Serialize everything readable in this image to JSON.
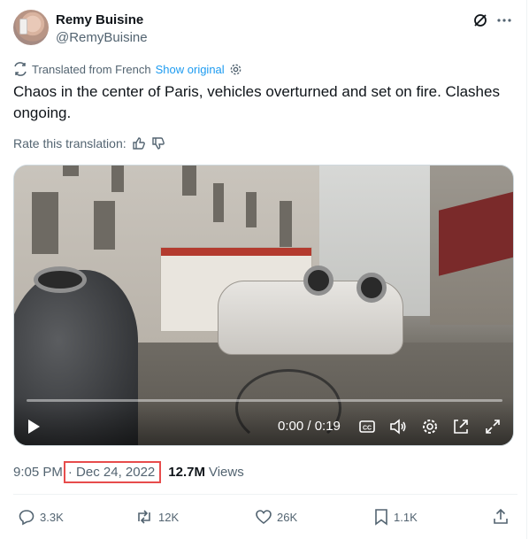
{
  "author": {
    "name": "Remy Buisine",
    "handle": "@RemyBuisine"
  },
  "header_icons": [
    "grok-icon",
    "more-icon"
  ],
  "translation": {
    "label": "Translated from French",
    "link": "Show original"
  },
  "tweet": {
    "text": "Chaos in the center of Paris, vehicles overturned and set on fire. Clashes ongoing."
  },
  "rate": {
    "label": "Rate this translation:"
  },
  "video": {
    "time": "0:00 / 0:19",
    "progress": 0
  },
  "meta": {
    "time": "9:05 PM",
    "sep": "·",
    "date": "Dec 24, 2022",
    "views_count": "12.7M",
    "views_label": "Views"
  },
  "actions": {
    "replies": "3.3K",
    "reposts": "12K",
    "likes": "26K",
    "bookmarks": "1.1K"
  },
  "colors": {
    "accent": "#1d9bf0",
    "text": "#0f1419",
    "muted": "#536471",
    "highlight_box": "#e74c4c"
  }
}
